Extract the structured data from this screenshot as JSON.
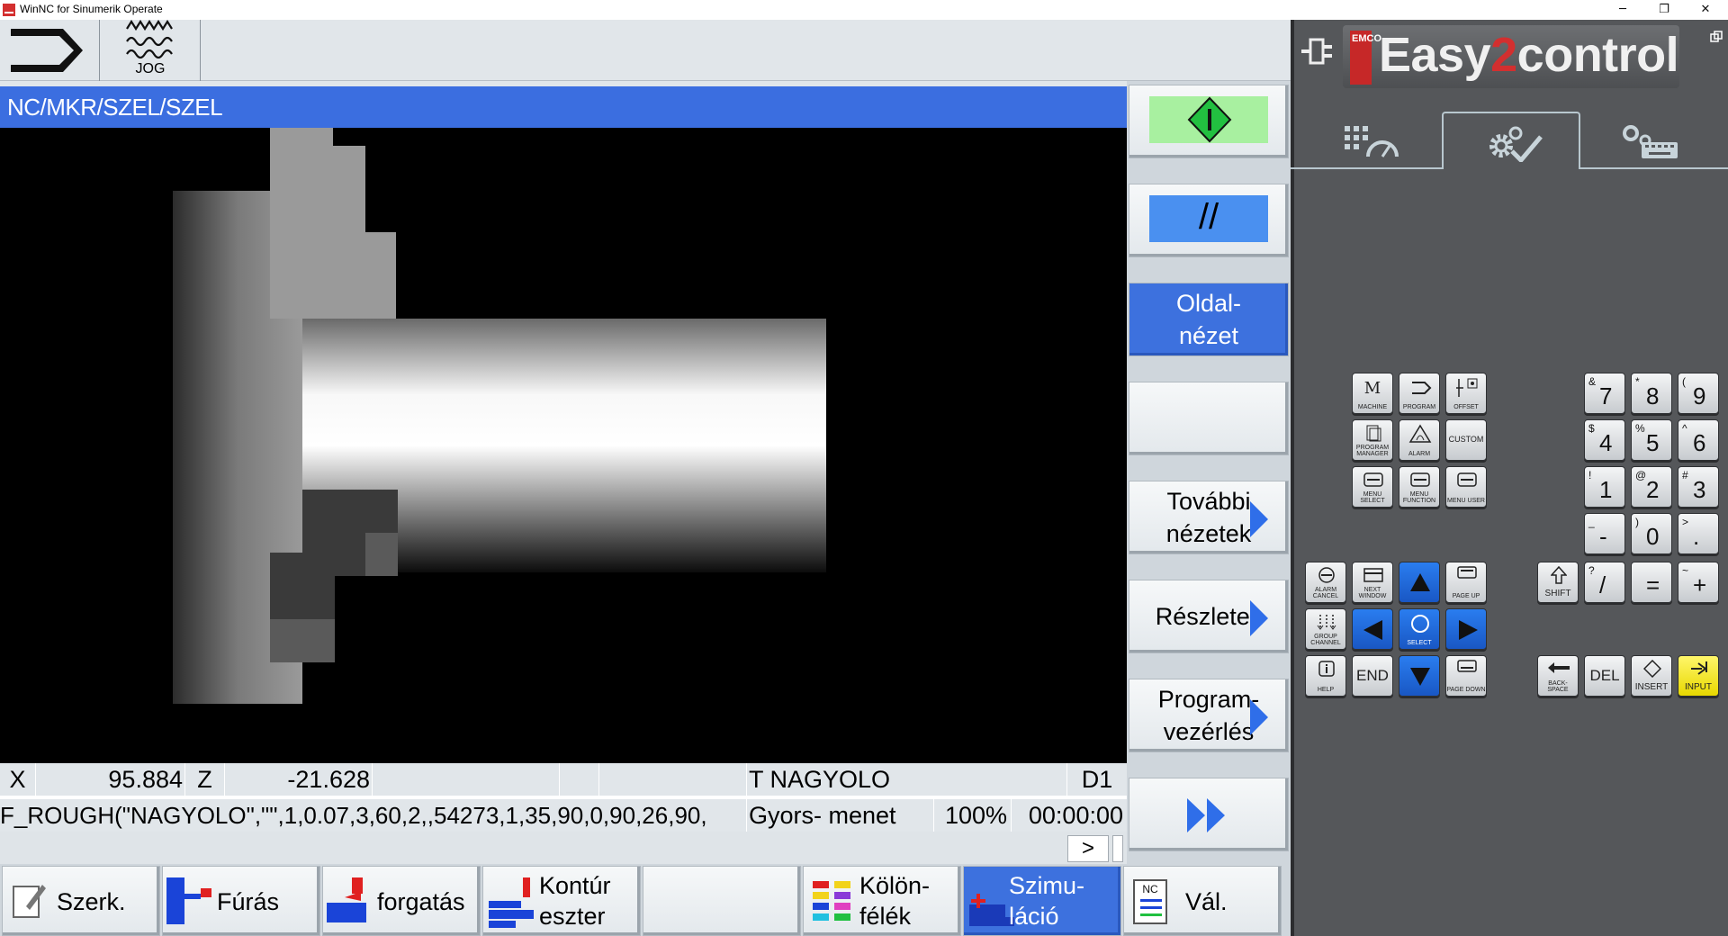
{
  "window": {
    "title": "WinNC for Sinumerik Operate",
    "minimize_glyph": "─",
    "restore_glyph": "❐",
    "close_glyph": "✕"
  },
  "mode": {
    "jog_label": "JOG"
  },
  "path": "NC/MKR/SZEL/SZEL",
  "status": {
    "x_label": "X",
    "x_value": "95.884",
    "z_label": "Z",
    "z_value": "-21.628",
    "tool": "T NAGYOLO",
    "d": "D1",
    "program_line": "F_ROUGH(\"NAGYOLO\",\"\",1,0.07,3,60,2,,54273,1,35,90,0,90,26,90,",
    "rapid": "Gyors- menet",
    "override": "100%",
    "time": "00:00:00",
    "more": ">"
  },
  "vertical_softkeys": [
    {
      "id": "start",
      "label": ""
    },
    {
      "id": "single",
      "label": "//"
    },
    {
      "id": "side-view",
      "line1": "Oldal-",
      "line2": "nézet"
    },
    {
      "id": "empty",
      "label": ""
    },
    {
      "id": "more-views",
      "line1": "További",
      "line2": "nézetek"
    },
    {
      "id": "details",
      "line1": "Részletek"
    },
    {
      "id": "program-control",
      "line1": "Program-",
      "line2": "vezérlés"
    },
    {
      "id": "fast-forward",
      "label": ""
    }
  ],
  "horizontal_softkeys": [
    {
      "id": "edit",
      "line1": "Szerk."
    },
    {
      "id": "drilling",
      "line1": "Fúrás"
    },
    {
      "id": "turning",
      "line1": "forgatás"
    },
    {
      "id": "contour",
      "line1": "Kontúr",
      "line2": "eszter"
    },
    {
      "id": "empty",
      "line1": ""
    },
    {
      "id": "misc",
      "line1": "Kölön-",
      "line2": "félék"
    },
    {
      "id": "simulation",
      "line1": "Szimu-",
      "line2": "láció"
    },
    {
      "id": "select",
      "line1": "Vál.",
      "nc_badge": "NC"
    }
  ],
  "panel": {
    "brand_emco": "EMCO",
    "brand_easy": "Easy",
    "brand_two": "2",
    "brand_control": "control",
    "control_keys": {
      "machine_main": "M",
      "machine": "MACHINE",
      "program": "PROGRAM",
      "offset": "OFFSET",
      "program_manager": "PROGRAM MANAGER",
      "alarm": "ALARM",
      "custom": "CUSTOM",
      "menu_select": "MENU SELECT",
      "menu_function": "MENU FUNCTION",
      "menu_user": "MENU USER",
      "alarm_cancel": "ALARM CANCEL",
      "next_window": "NEXT WINDOW",
      "page_up": "PAGE UP",
      "group_channel": "GROUP CHANNEL",
      "select": "SELECT",
      "help": "HELP",
      "end": "END",
      "page_down": "PAGE DOWN",
      "shift": "SHIFT",
      "backspace": "BACK-SPACE",
      "del": "DEL",
      "insert": "INSERT",
      "input": "INPUT"
    },
    "numpad": [
      {
        "big": "7",
        "small": "&"
      },
      {
        "big": "8",
        "small": "*"
      },
      {
        "big": "9",
        "small": "("
      },
      {
        "big": "4",
        "small": "$"
      },
      {
        "big": "5",
        "small": "%"
      },
      {
        "big": "6",
        "small": "^"
      },
      {
        "big": "1",
        "small": "!"
      },
      {
        "big": "2",
        "small": "@"
      },
      {
        "big": "3",
        "small": "#"
      },
      {
        "big": "-",
        "small": "_"
      },
      {
        "big": "0",
        "small": ")"
      },
      {
        "big": ".",
        "small": ">"
      },
      {
        "big": "/",
        "small": "?"
      },
      {
        "big": "=",
        "small": ""
      },
      {
        "big": "+",
        "small": "~"
      }
    ]
  }
}
